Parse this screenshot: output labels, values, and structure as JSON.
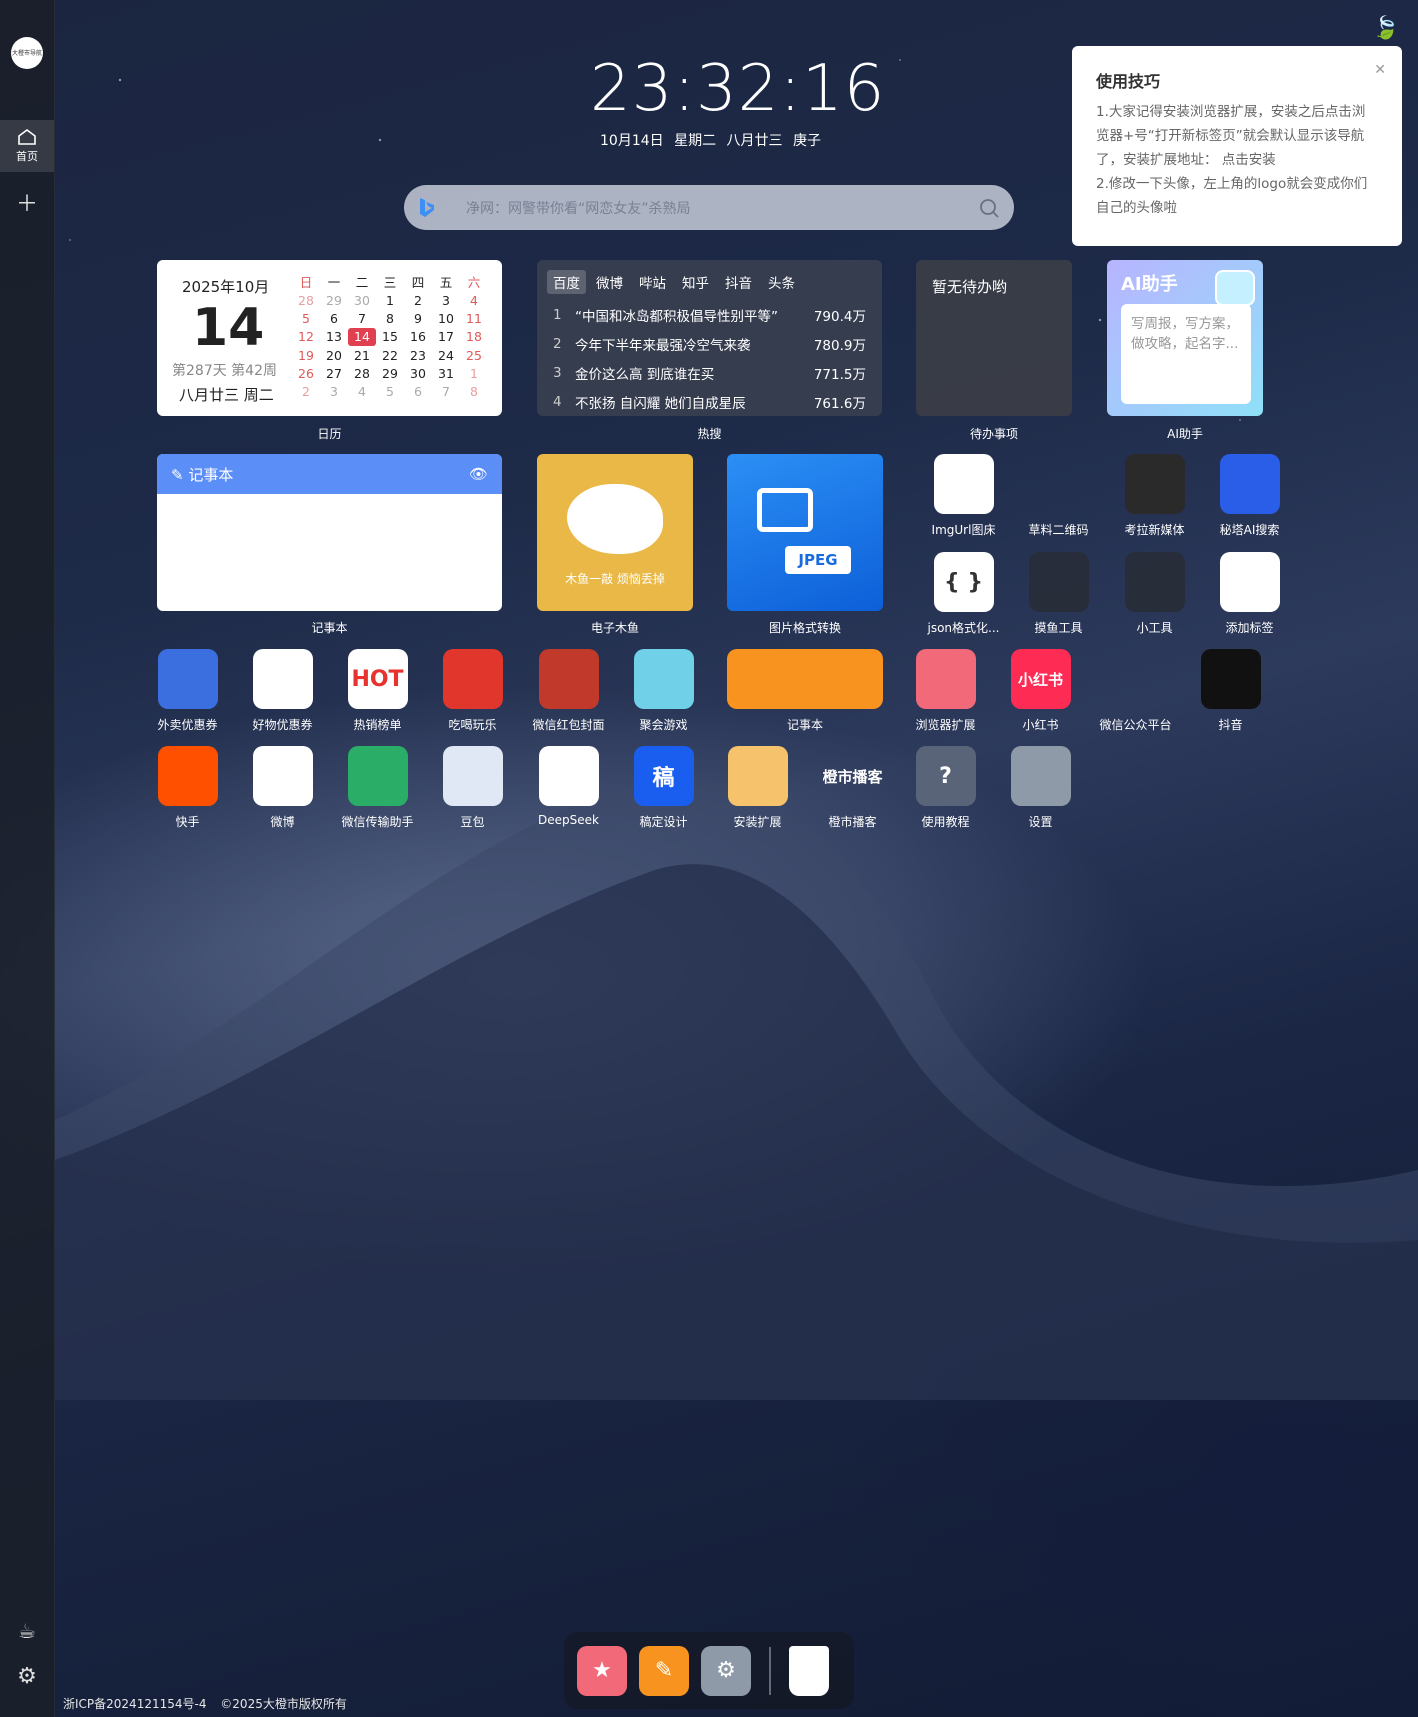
{
  "sidebar": {
    "logo_text": "大橙市导航",
    "home_label": "首页"
  },
  "clock": {
    "time": "23:32:16",
    "date": "10月14日 星期二 八月廿三 庚子"
  },
  "search": {
    "placeholder": "净网：网警带你看“网恋女友”杀熟局"
  },
  "tips": {
    "title": "使用技巧",
    "line1": "1.大家记得安装浏览器扩展，安装之后点击浏览器+号“打开新标签页”就会默认显示该导航了，安装扩展地址： 点击安装",
    "line2": "2.修改一下头像，左上角的logo就会变成你们自己的头像啦"
  },
  "calendar": {
    "year_month": "2025年10月",
    "day": "14",
    "week_info": "第287天 第42周",
    "lunar": "八月廿三 周二",
    "label": "日历",
    "headers": [
      "日",
      "一",
      "二",
      "三",
      "四",
      "五",
      "六"
    ],
    "weeks": [
      [
        "28",
        "29",
        "30",
        "1",
        "2",
        "3",
        "4"
      ],
      [
        "5",
        "6",
        "7",
        "8",
        "9",
        "10",
        "11"
      ],
      [
        "12",
        "13",
        "14",
        "15",
        "16",
        "17",
        "18"
      ],
      [
        "19",
        "20",
        "21",
        "22",
        "23",
        "24",
        "25"
      ],
      [
        "26",
        "27",
        "28",
        "29",
        "30",
        "31",
        "1"
      ],
      [
        "2",
        "3",
        "4",
        "5",
        "6",
        "7",
        "8"
      ]
    ]
  },
  "hot": {
    "label": "热搜",
    "tabs": [
      "百度",
      "微博",
      "哔站",
      "知乎",
      "抖音",
      "头条"
    ],
    "items": [
      {
        "n": "1",
        "t": "“中国和冰岛都积极倡导性别平等”",
        "v": "790.4万"
      },
      {
        "n": "2",
        "t": "今年下半年来最强冷空气来袭",
        "v": "780.9万"
      },
      {
        "n": "3",
        "t": "金价这么高 到底谁在买",
        "v": "771.5万"
      },
      {
        "n": "4",
        "t": "不张扬 自闪耀 她们自成星辰",
        "v": "761.6万"
      }
    ]
  },
  "todo": {
    "text": "暂无待办哟",
    "label": "待办事项"
  },
  "ai": {
    "title": "AI助手",
    "placeholder": "写周报，写方案，做攻略，起名字...",
    "label": "AI助手"
  },
  "note": {
    "title": "记事本",
    "label": "记事本"
  },
  "muyu": {
    "caption": "木鱼一敲 烦恼丢掉",
    "label": "电子木鱼"
  },
  "jpeg": {
    "tag": "JPEG",
    "label": "图片格式转换"
  },
  "apps": {
    "imgurl": "ImgUrl图床",
    "caoliao": "草料二维码",
    "koala": "考拉新媒体",
    "mita": "秘塔AI搜索",
    "json": "json格式化...",
    "moyu": "摸鱼工具",
    "tools": "小工具",
    "add": "添加标签",
    "waimai": "外卖优惠券",
    "haowu": "好物优惠券",
    "rexiao": "热销榜单",
    "chihe": "吃喝玩乐",
    "hongbao": "微信红包封面",
    "games": "聚会游戏",
    "jishiben": "记事本",
    "extension": "浏览器扩展",
    "xhs": "小红书",
    "wxmp": "微信公众平台",
    "douyin": "抖音",
    "kuaishou": "快手",
    "weibo": "微博",
    "wxtransfer": "微信传输助手",
    "doubao": "豆包",
    "deepseek": "DeepSeek",
    "gaoding": "稿定设计",
    "install": "安装扩展",
    "chengshi": "橙市播客",
    "tutorial": "使用教程",
    "settings": "设置"
  },
  "app_glyphs": {
    "json": "{ }",
    "gaoding": "稿",
    "xhs": "小红书",
    "tutorial": "?",
    "rexiao": "HOT",
    "chengshi": "橙市播客"
  },
  "footer": {
    "icp": "浙ICP备2024121154号-4",
    "copyright": "©2025大橙市版权所有"
  }
}
